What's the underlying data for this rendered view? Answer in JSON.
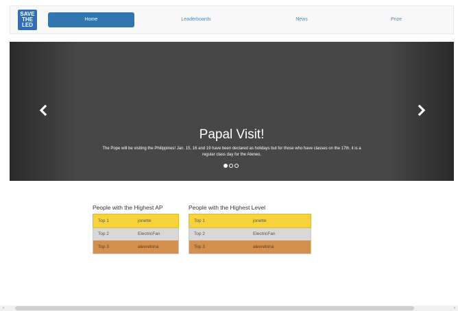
{
  "logo": {
    "lines": [
      "SAVE",
      "THE",
      "LED"
    ]
  },
  "nav": {
    "items": [
      {
        "label": "Home",
        "active": true
      },
      {
        "label": "Leaderboards",
        "active": false
      },
      {
        "label": "News",
        "active": false
      },
      {
        "label": "Prize",
        "active": false
      }
    ]
  },
  "carousel": {
    "title": "Papal Visit!",
    "text": "The Pope will be visiting the Philippines! Jan. 15, 16 and 19 have been declared as holidays but for those who have classes on the 17th, it is a regular class day for the Ateneo.",
    "slide_count": 3,
    "active_slide": 1,
    "prev_icon": "chevron-left-icon",
    "next_icon": "chevron-right-icon"
  },
  "boards": [
    {
      "title": "People with the Highest AP",
      "rows": [
        {
          "rank": "Top 1",
          "name": "jonette"
        },
        {
          "rank": "Top 2",
          "name": "ElectricFan"
        },
        {
          "rank": "Top 3",
          "name": "alexretona"
        }
      ]
    },
    {
      "title": "People with the Highest Level",
      "rows": [
        {
          "rank": "Top 1",
          "name": "jonette"
        },
        {
          "rank": "Top 2",
          "name": "ElectricFan"
        },
        {
          "rank": "Top 3",
          "name": "alexretona"
        }
      ]
    }
  ],
  "colors": {
    "nav_active": "#3276b1",
    "gold": "#f6d33b",
    "silver": "#d8d8d8",
    "bronze": "#d4914d"
  },
  "scrollbar": {
    "left_arrow": "‹",
    "right_arrow": "›"
  }
}
